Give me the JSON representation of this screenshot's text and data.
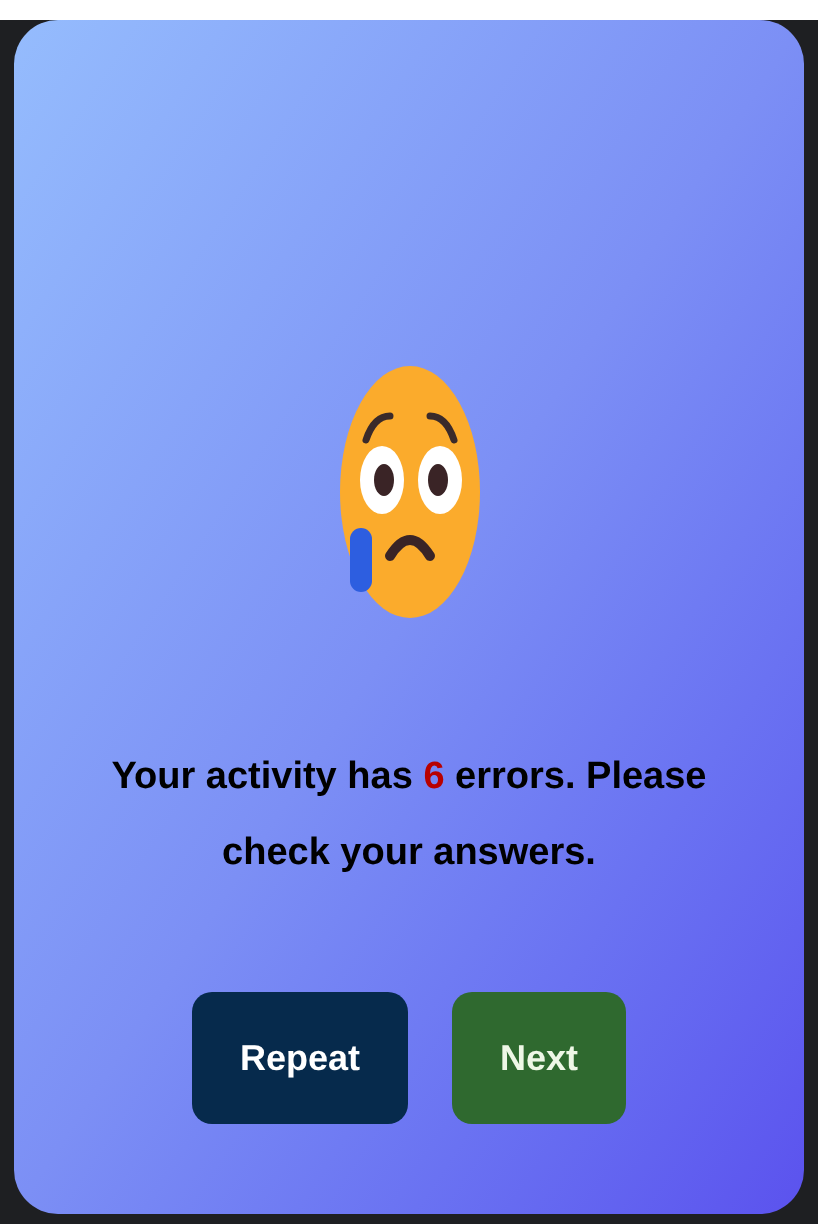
{
  "message": {
    "before": "Your activity has ",
    "error_count": "6",
    "after": " errors. Please check your answers."
  },
  "buttons": [
    {
      "label": "Repeat",
      "kind": "repeat"
    },
    {
      "label": "Next",
      "kind": "next"
    }
  ]
}
